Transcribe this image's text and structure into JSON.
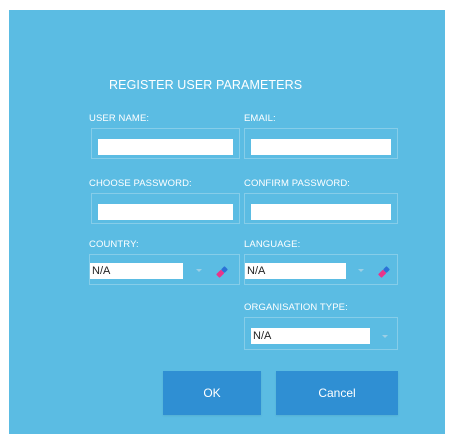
{
  "dialog": {
    "title": "REGISTER USER PARAMETERS"
  },
  "fields": {
    "user_name": {
      "label": "USER NAME:",
      "value": ""
    },
    "email": {
      "label": "EMAIL:",
      "value": ""
    },
    "choose_password": {
      "label": "CHOOSE PASSWORD:",
      "value": ""
    },
    "confirm_password": {
      "label": "CONFIRM PASSWORD:",
      "value": ""
    },
    "country": {
      "label": "COUNTRY:",
      "selected": "N/A"
    },
    "language": {
      "label": "LANGUAGE:",
      "selected": "N/A"
    },
    "organisation_type": {
      "label": "ORGANISATION TYPE:",
      "selected": "N/A"
    }
  },
  "buttons": {
    "ok_label": "OK",
    "cancel_label": "Cancel"
  },
  "colors": {
    "dialog_bg": "#5bbce3",
    "button_bg": "#2f8fd3",
    "eraser_pink": "#e9348a",
    "eraser_blue": "#2b72d6"
  },
  "icons": {
    "dropdown": "chevron-down-icon",
    "clear": "eraser-icon"
  }
}
